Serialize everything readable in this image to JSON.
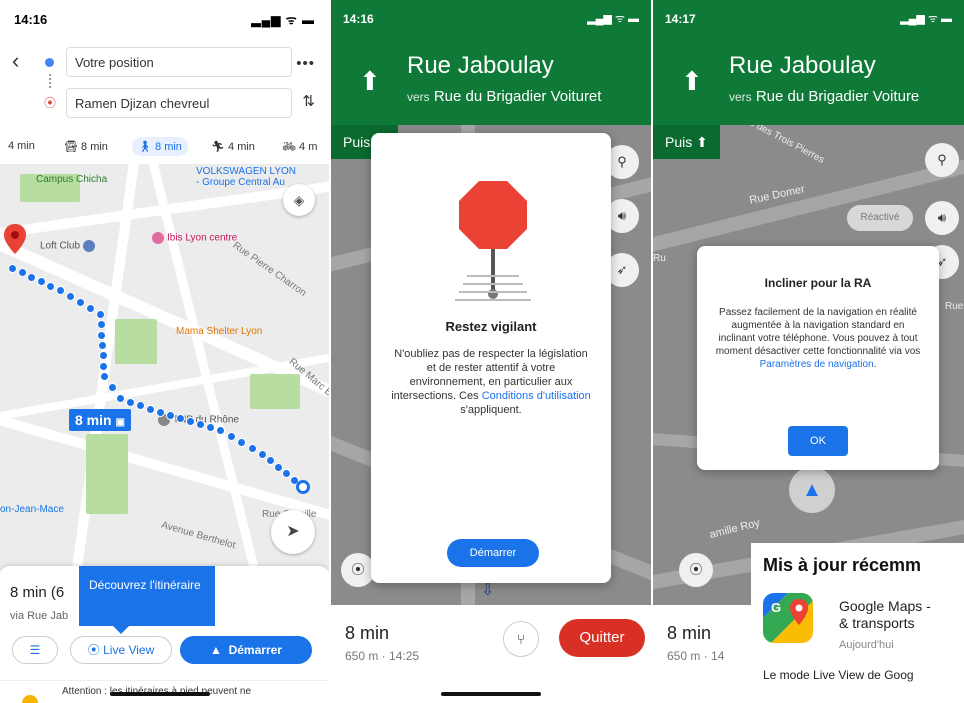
{
  "panel1": {
    "status": {
      "time": "14:16",
      "signal": "▂▄▆ ᯤ ▬"
    },
    "origin": "Votre position",
    "destination": "Ramen Djizan chevreul",
    "modes": [
      {
        "icon": "",
        "label": "4 min"
      },
      {
        "icon": "car-icon",
        "label": "8 min"
      },
      {
        "icon": "walk-icon",
        "label": "8 min"
      },
      {
        "icon": "rideshare-icon",
        "label": "4 min"
      },
      {
        "icon": "bike-icon",
        "label": "4 m"
      }
    ],
    "map": {
      "pois": [
        "Campus Chicha",
        "VOLKSWAGEN LYON",
        "- Groupe Central Au",
        "Loft Club",
        "Ibis Lyon centre",
        "Mama Shelter Lyon",
        "TNP du Rhône",
        "Rue Marc B",
        "Rue Pierre Charron",
        "on-Jean-Mace",
        "Avenue Berthelot",
        "Rue Camille"
      ],
      "duration_label": "8 min"
    },
    "sheet": {
      "duration": "8 min (6",
      "via": "via Rue Jab",
      "tooltip": "Découvrez l'itinéraire",
      "live_view": "Live View",
      "start": "Démarrer",
      "warning": "Attention : les itinéraires à pied peuvent ne"
    }
  },
  "panel2": {
    "status": {
      "time": "14:16"
    },
    "street": "Rue Jaboulay",
    "vers_prefix": "vers",
    "vers": "Rue du Brigadier Voituret",
    "then": "Puis",
    "modal": {
      "title": "Restez vigilant",
      "body": "N'oubliez pas de respecter la législation et de rester attentif à votre environnement, en particulier aux intersections. Ces",
      "link": "Conditions d'utilisation",
      "body_end": " s'appliquent.",
      "button": "Démarrer"
    },
    "bottom": {
      "duration": "8 min",
      "sub": "650 m · 14:25",
      "quit": "Quitter"
    }
  },
  "panel3": {
    "status": {
      "time": "14:17"
    },
    "street": "Rue Jaboulay",
    "vers_prefix": "vers",
    "vers": "Rue du Brigadier Voiture",
    "then": "Puis",
    "map": {
      "streets": [
        "Rue des Trois Pierres",
        "Rue Domer",
        "Rue",
        "Ru",
        "amille Roy"
      ],
      "reactive": "Réactivé"
    },
    "modal": {
      "title": "Incliner pour la RA",
      "body": "Passez facilement de la navigation en réalité augmentée à la navigation standard en inclinant votre téléphone. Vous pouvez à tout moment désactiver cette fonctionnalité via vos",
      "link": "Paramètres de navigation",
      "body_end": ".",
      "button": "OK"
    },
    "bottom": {
      "duration": "8 min",
      "sub": "650 m · 14"
    },
    "appstore": {
      "title": "Mis à jour récemm",
      "app_name_1": "Google Maps -",
      "app_name_2": "& transports",
      "date": "Aujourd'hui",
      "desc": "Le mode Live View de Goog"
    }
  },
  "colors": {
    "nav_green": "#0f7a37",
    "accent_blue": "#1a73e8",
    "quit_red": "#d93025"
  }
}
